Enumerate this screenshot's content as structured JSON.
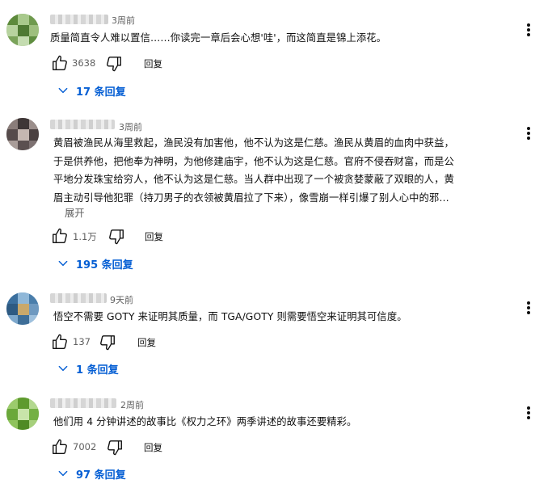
{
  "comments": [
    {
      "time": "3周前",
      "text": [
        "质量简直令人难以置信……你读完一章后会心想'哇'，而这简直是锦上添花。"
      ],
      "likes": "3638",
      "reply_label": "回复",
      "replies": "17 条回复"
    },
    {
      "time": "3周前",
      "text": [
        "黄眉被渔民从海里救起，渔民没有加害他，他不认为这是仁慈。渔民从黄眉的血肉中获益，",
        "于是供养他，把他奉为神明，为他修建庙宇，他不认为这是仁慈。官府不侵吞财富，而是公",
        "平地分发珠宝给穷人，他不认为这是仁慈。当人群中出现了一个被贪婪蒙蔽了双眼的人，黄",
        "眉主动引导他犯罪（持刀男子的衣领被黄眉拉了下来），像雪崩一样引爆了别人心中的邪…"
      ],
      "expand": "展开",
      "likes": "1.1万",
      "reply_label": "回复",
      "replies": "195 条回复"
    },
    {
      "time": "9天前",
      "text": [
        "悟空不需要 GOTY 来证明其质量，而 TGA/GOTY 则需要悟空来证明其可信度。"
      ],
      "likes": "137",
      "reply_label": "回复",
      "replies": "1 条回复"
    },
    {
      "time": "2周前",
      "text": [
        "他们用 4 分钟讲述的故事比《权力之环》两季讲述的故事还要精彩。"
      ],
      "likes": "7002",
      "reply_label": "回复",
      "replies": "97 条回复"
    }
  ],
  "colors": {
    "link": "#065fd4",
    "secondary": "#606060",
    "text": "#0f0f0f"
  }
}
